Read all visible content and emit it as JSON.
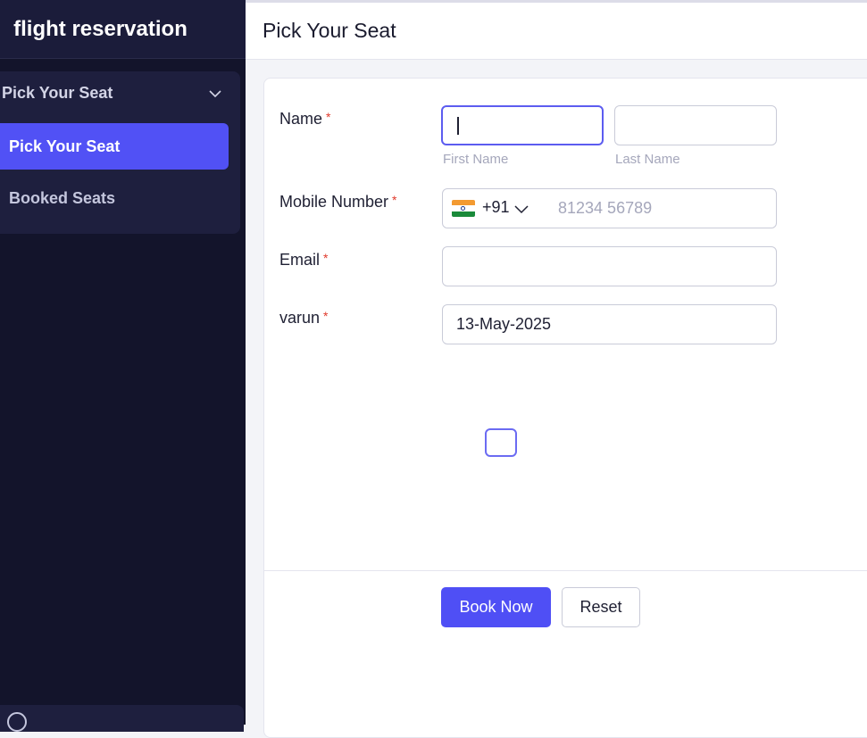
{
  "app": {
    "title": "flight reservation"
  },
  "sidebar": {
    "group_label": "Pick Your Seat",
    "items": [
      {
        "label": "Pick Your Seat",
        "active": true
      },
      {
        "label": "Booked Seats",
        "active": false
      }
    ]
  },
  "header": {
    "title": "Pick Your Seat"
  },
  "form": {
    "name": {
      "label": "Name",
      "required_mark": "*",
      "first_value": "",
      "first_hint": "First Name",
      "last_value": "",
      "last_hint": "Last Name"
    },
    "mobile": {
      "label": "Mobile Number",
      "required_mark": "*",
      "country_code": "+91",
      "country_flag": "india-flag-icon",
      "placeholder": "81234 56789"
    },
    "email": {
      "label": "Email",
      "required_mark": "*",
      "value": ""
    },
    "date": {
      "label": "varun",
      "required_mark": "*",
      "value": "13-May-2025"
    },
    "checkbox": {
      "checked": false
    }
  },
  "actions": {
    "submit_label": "Book Now",
    "reset_label": "Reset"
  },
  "colors": {
    "accent": "#4f4ff5",
    "sidebar_bg": "#13142b",
    "required": "#e0392b"
  }
}
